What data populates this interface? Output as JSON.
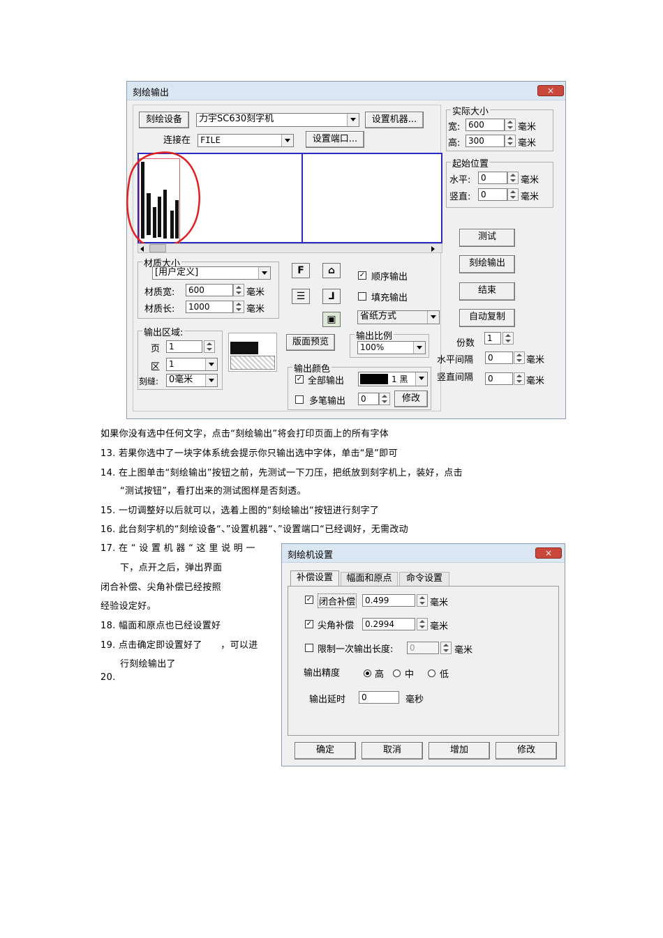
{
  "dialog1": {
    "title": "刻绘输出",
    "close": "×",
    "device_btn": "刻绘设备",
    "device_value": "力宇SC630刻字机",
    "setup_machine_btn": "设置机器...",
    "connect_label": "连接在",
    "connect_value": "FILE",
    "setup_port_btn": "设置端口...",
    "actual_size": {
      "title": "实际大小",
      "width_label": "宽:",
      "width": "600",
      "height_label": "高:",
      "height": "300",
      "unit": "毫米"
    },
    "start_pos": {
      "title": "起始位置",
      "h_label": "水平:",
      "h": "0",
      "v_label": "竖直:",
      "v": "0",
      "unit": "毫米"
    },
    "material": {
      "title": "材质大小",
      "preset": "[用户定义]",
      "width_label": "材质宽:",
      "width": "600",
      "length_label": "材质长:",
      "length": "1000",
      "unit": "毫米"
    },
    "checkbox_order": "顺序输出",
    "checkbox_fill": "填充输出",
    "paper_mode": "省纸方式",
    "output_area": {
      "title": "输出区域:",
      "page_label": "页",
      "page": "1",
      "zone_label": "区",
      "zone": "1",
      "gap_label": "刻缝:",
      "gap": "0毫米"
    },
    "preview_btn": "版面预览",
    "scale": {
      "title": "输出比例",
      "value": "100%"
    },
    "color": {
      "title": "输出颜色",
      "all_label": "全部输出",
      "pen": "1 黑",
      "multi_label": "多笔输出",
      "multi_value": "0",
      "modify_btn": "修改"
    },
    "test_btn": "测试",
    "output_btn": "刻绘输出",
    "end_btn": "结束",
    "auto_copy_btn": "自动复制",
    "copies_label": "份数",
    "copies": "1",
    "h_spacing_label": "水平间隔",
    "h_spacing": "0",
    "v_spacing_label": "竖直间隔",
    "v_spacing": "0",
    "unit": "毫米",
    "icons": [
      "F-icon",
      "portrait-icon",
      "align-icon",
      "mirror-icon",
      "image-icon"
    ]
  },
  "doc": {
    "line0": "如果你没有选中任何文字，点击“刻绘输出”将会打印页面上的所有字体",
    "line13": "13.  若果你选中了一块字体系统会提示你只输出选中字体，单击“是”即可",
    "line14a": "14.  在上图单击“刻绘输出”按钮之前，先测试一下刀压，把纸放到刻字机上，装好，点击",
    "line14b": "“测试按钮”，看打出来的测试图样是否刻透。",
    "line15": "15.  一切调整好以后就可以，选着上图的“刻绘输出“按钮进行刻字了",
    "line16": "16.  此台刻字机的“刻绘设备“、”设置机器“、”设置端口“已经调好，无需改动",
    "line17a": "17.  在 “ 设 置 机 器 “ 这 里 说 明 一",
    "line17b": "下，点开之后，弹出界面",
    "line17c": "闭合补偿、尖角补偿已经按照",
    "line17d": "经验设定好。",
    "line18": "18.  幅面和原点也已经设置好",
    "line19a": "19.  点击确定即设置好了　　，可以进",
    "line19b": "行刻绘输出了",
    "line20": "20."
  },
  "dialog2": {
    "title": "刻绘机设置",
    "close": "×",
    "tabs": [
      "补偿设置",
      "幅面和原点",
      "命令设置"
    ],
    "closed_comp_label": "闭合补偿",
    "closed_comp": "0.499",
    "corner_comp_label": "尖角补偿",
    "corner_comp": "0.2994",
    "limit_label": "限制一次输出长度:",
    "limit": "0",
    "unit": "毫米",
    "precision_label": "输出精度",
    "precision_options": [
      "高",
      "中",
      "低"
    ],
    "delay_label": "输出延时",
    "delay": "0",
    "delay_unit": "毫秒",
    "buttons": [
      "确定",
      "取消",
      "增加",
      "修改"
    ]
  }
}
